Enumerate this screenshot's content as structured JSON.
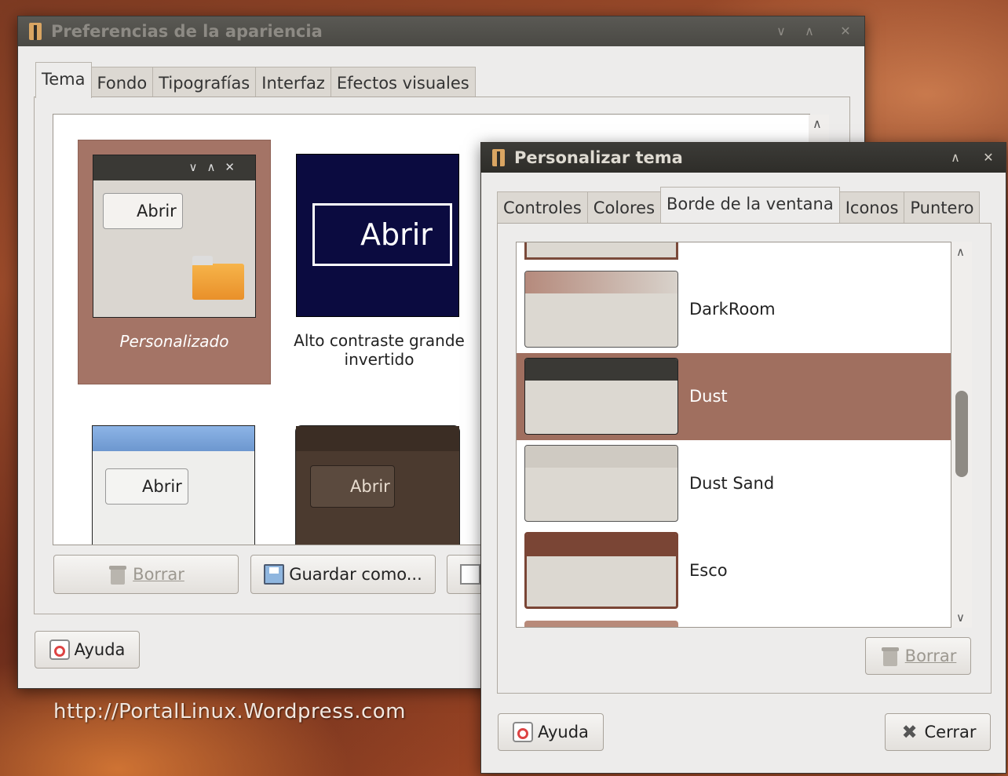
{
  "main_window": {
    "title": "Preferencias de la apariencia",
    "tabs": [
      "Tema",
      "Fondo",
      "Tipografías",
      "Interfaz",
      "Efectos visuales"
    ],
    "themes": [
      {
        "label": "Personalizado",
        "preview_button": "Abrir"
      },
      {
        "label": "Alto contraste grande invertido",
        "preview_button": "Abrir"
      },
      {
        "label": "",
        "preview_button": "Abrir"
      },
      {
        "label": "",
        "preview_button": "Abrir"
      }
    ],
    "buttons": {
      "delete": "Borrar",
      "save_as": "Guardar como..."
    },
    "help": "Ayuda"
  },
  "dialog": {
    "title": "Personalizar tema",
    "tabs": [
      "Controles",
      "Colores",
      "Borde de la ventana",
      "Iconos",
      "Puntero"
    ],
    "borders": [
      "DarkRoom",
      "Dust",
      "Dust Sand",
      "Esco"
    ],
    "selected_border": "Dust",
    "buttons": {
      "delete": "Borrar",
      "help": "Ayuda",
      "close": "Cerrar"
    }
  },
  "watermark": "http://PortalLinux.Wordpress.com",
  "colors": {
    "selection": "#a06f5f",
    "titlebar": "#3c3b37"
  }
}
